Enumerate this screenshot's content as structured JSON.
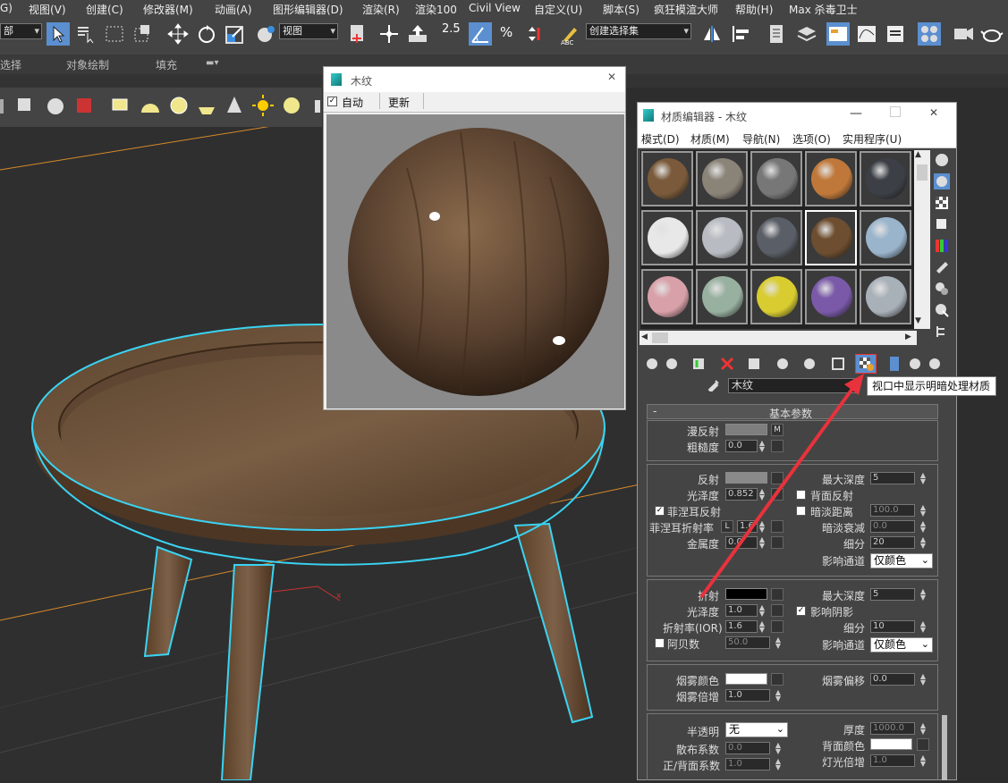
{
  "main_menu": [
    "G)",
    "视图(V)",
    "创建(C)",
    "修改器(M)",
    "动画(A)",
    "图形编辑器(D)",
    "渲染(R)",
    "渲染100",
    "Civil View",
    "自定义(U)",
    "脚本(S)",
    "疯狂模渲大师",
    "帮助(H)",
    "Max 杀毒卫士"
  ],
  "toolbar": {
    "selection_filter": "部",
    "ref_coord": "视图",
    "snap_value": "2.5",
    "named_selection": "创建选择集"
  },
  "ribbon": {
    "items": [
      "选择",
      "对象绘制",
      "填充"
    ]
  },
  "preview": {
    "title": "木纹",
    "auto_label": "自动",
    "auto_checked": true,
    "update_label": "更新"
  },
  "mated": {
    "title": "材质编辑器 - 木纹",
    "menus": [
      "模式(D)",
      "材质(M)",
      "导航(N)",
      "选项(O)",
      "实用程序(U)"
    ],
    "material_name": "木纹",
    "tooltip": "视口中显示明暗处理材质",
    "rollout_title": "基本参数",
    "colors": {
      "slots": [
        "#7a5a3a",
        "#8a8378",
        "#777",
        "#c0783a",
        "#3c4046",
        "#e8e8e8",
        "#b8bcc2",
        "#5a5e66",
        "#6e4e30",
        "#9ab4cc",
        "#d8a0a8",
        "#98b0a0",
        "#d8cc30",
        "#7a5aa8",
        "#a8b0b8"
      ]
    },
    "basic": {
      "diffuse": "漫反射",
      "diffuse_map": "M",
      "roughness": "粗糙度",
      "roughness_val": "0.0"
    },
    "reflection": {
      "reflect": "反射",
      "gloss": "光泽度",
      "gloss_val": "0.852",
      "fresnel": "菲涅耳反射",
      "fresnel_ior": "菲涅耳折射率",
      "fresnel_ior_lock": "L",
      "fresnel_ior_val": "1.6",
      "metal": "金属度",
      "metal_val": "0.0",
      "max_depth": "最大深度",
      "max_depth_val": "5",
      "back_reflect": "背面反射",
      "dim_dist": "暗淡距离",
      "dim_dist_val": "100.0",
      "dim_falloff": "暗淡衰减",
      "dim_falloff_val": "0.0",
      "subdivs": "细分",
      "subdivs_val": "20",
      "affect_ch": "影响通道",
      "affect_ch_val": "仅颜色"
    },
    "refraction": {
      "refract": "折射",
      "gloss": "光泽度",
      "gloss_val": "1.0",
      "ior": "折射率(IOR)",
      "ior_val": "1.6",
      "abbe": "阿贝数",
      "abbe_val": "50.0",
      "max_depth": "最大深度",
      "max_depth_val": "5",
      "affect_shadows": "影响阴影",
      "subdivs": "细分",
      "subdivs_val": "10",
      "affect_ch": "影响通道",
      "affect_ch_val": "仅颜色"
    },
    "fog": {
      "color": "烟雾颜色",
      "mult": "烟雾倍增",
      "mult_val": "1.0",
      "bias": "烟雾偏移",
      "bias_val": "0.0"
    },
    "translucency": {
      "type": "半透明",
      "type_val": "无",
      "scatter": "散布系数",
      "scatter_val": "0.0",
      "fb": "正/背面系数",
      "fb_val": "1.0",
      "thickness": "厚度",
      "thickness_val": "1000.0",
      "back_color": "背面颜色",
      "light_mult": "灯光倍增",
      "light_mult_val": "1.0"
    }
  }
}
